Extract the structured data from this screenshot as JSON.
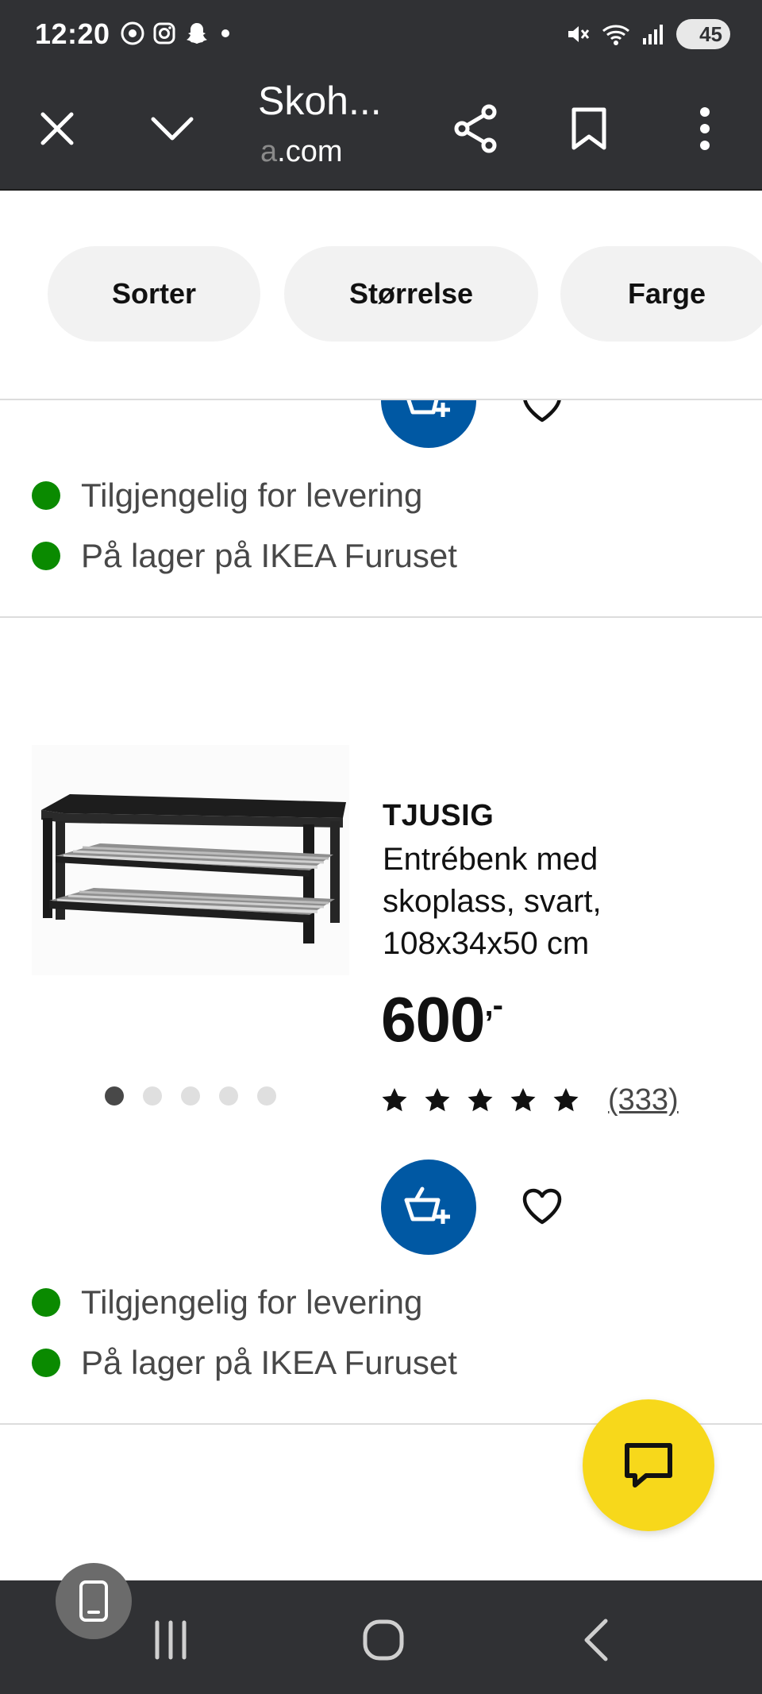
{
  "status_bar": {
    "time": "12:20",
    "battery": "45",
    "left_icons": [
      "chrome-icon",
      "instagram-icon",
      "snapchat-icon",
      "dot-icon"
    ],
    "right_icons": [
      "mute-icon",
      "wifi-icon",
      "signal-icon"
    ]
  },
  "toolbar": {
    "title": "Skoh...",
    "url_faded": "a",
    "url_main": ".com"
  },
  "filters": {
    "sort": "Sorter",
    "size": "Størrelse",
    "color": "Farge"
  },
  "previous_product": {
    "availability": [
      "Tilgjengelig for levering",
      "På lager på IKEA Furuset"
    ]
  },
  "product": {
    "name": "TJUSIG",
    "description": "Entrébenk med skoplass, svart, 108x34x50 cm",
    "price": "600",
    "price_suffix": ",-",
    "rating_stars": 5,
    "rating_count": "(333)",
    "image_count": 5,
    "active_image": 1,
    "availability": [
      "Tilgjengelig for levering",
      "På lager på IKEA Furuset"
    ]
  },
  "colors": {
    "toolbar_bg": "#303134",
    "cart_blue": "#0058a3",
    "stock_green": "#0a8a00",
    "chat_yellow": "#f7d81b"
  }
}
